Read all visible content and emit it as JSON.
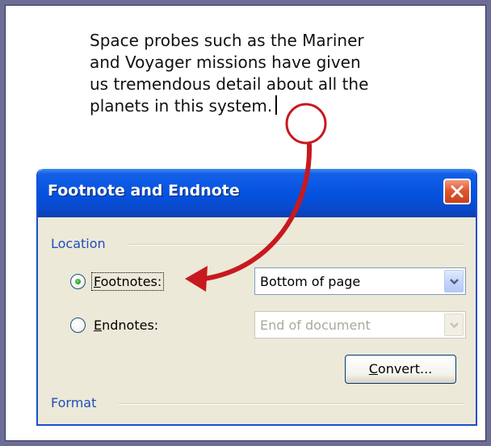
{
  "document": {
    "lines": [
      "Space probes such as the Mariner",
      "and Voyager missions have given",
      "us tremendous detail about all the",
      "planets in this system."
    ]
  },
  "dialog": {
    "title": "Footnote and Endnote",
    "location_group": "Location",
    "footnotes": {
      "label_key": "F",
      "label_rest": "ootnotes:",
      "checked": true,
      "select_value": "Bottom of page"
    },
    "endnotes": {
      "label_key": "E",
      "label_rest": "ndnotes:",
      "checked": false,
      "select_value": "End of document"
    },
    "convert_key": "C",
    "convert_rest": "onvert...",
    "format_group": "Format"
  },
  "colors": {
    "background": "#6b6d96",
    "titlebar": "#0451de",
    "annotation": "#c8191f",
    "group_label": "#1f4fbd"
  }
}
